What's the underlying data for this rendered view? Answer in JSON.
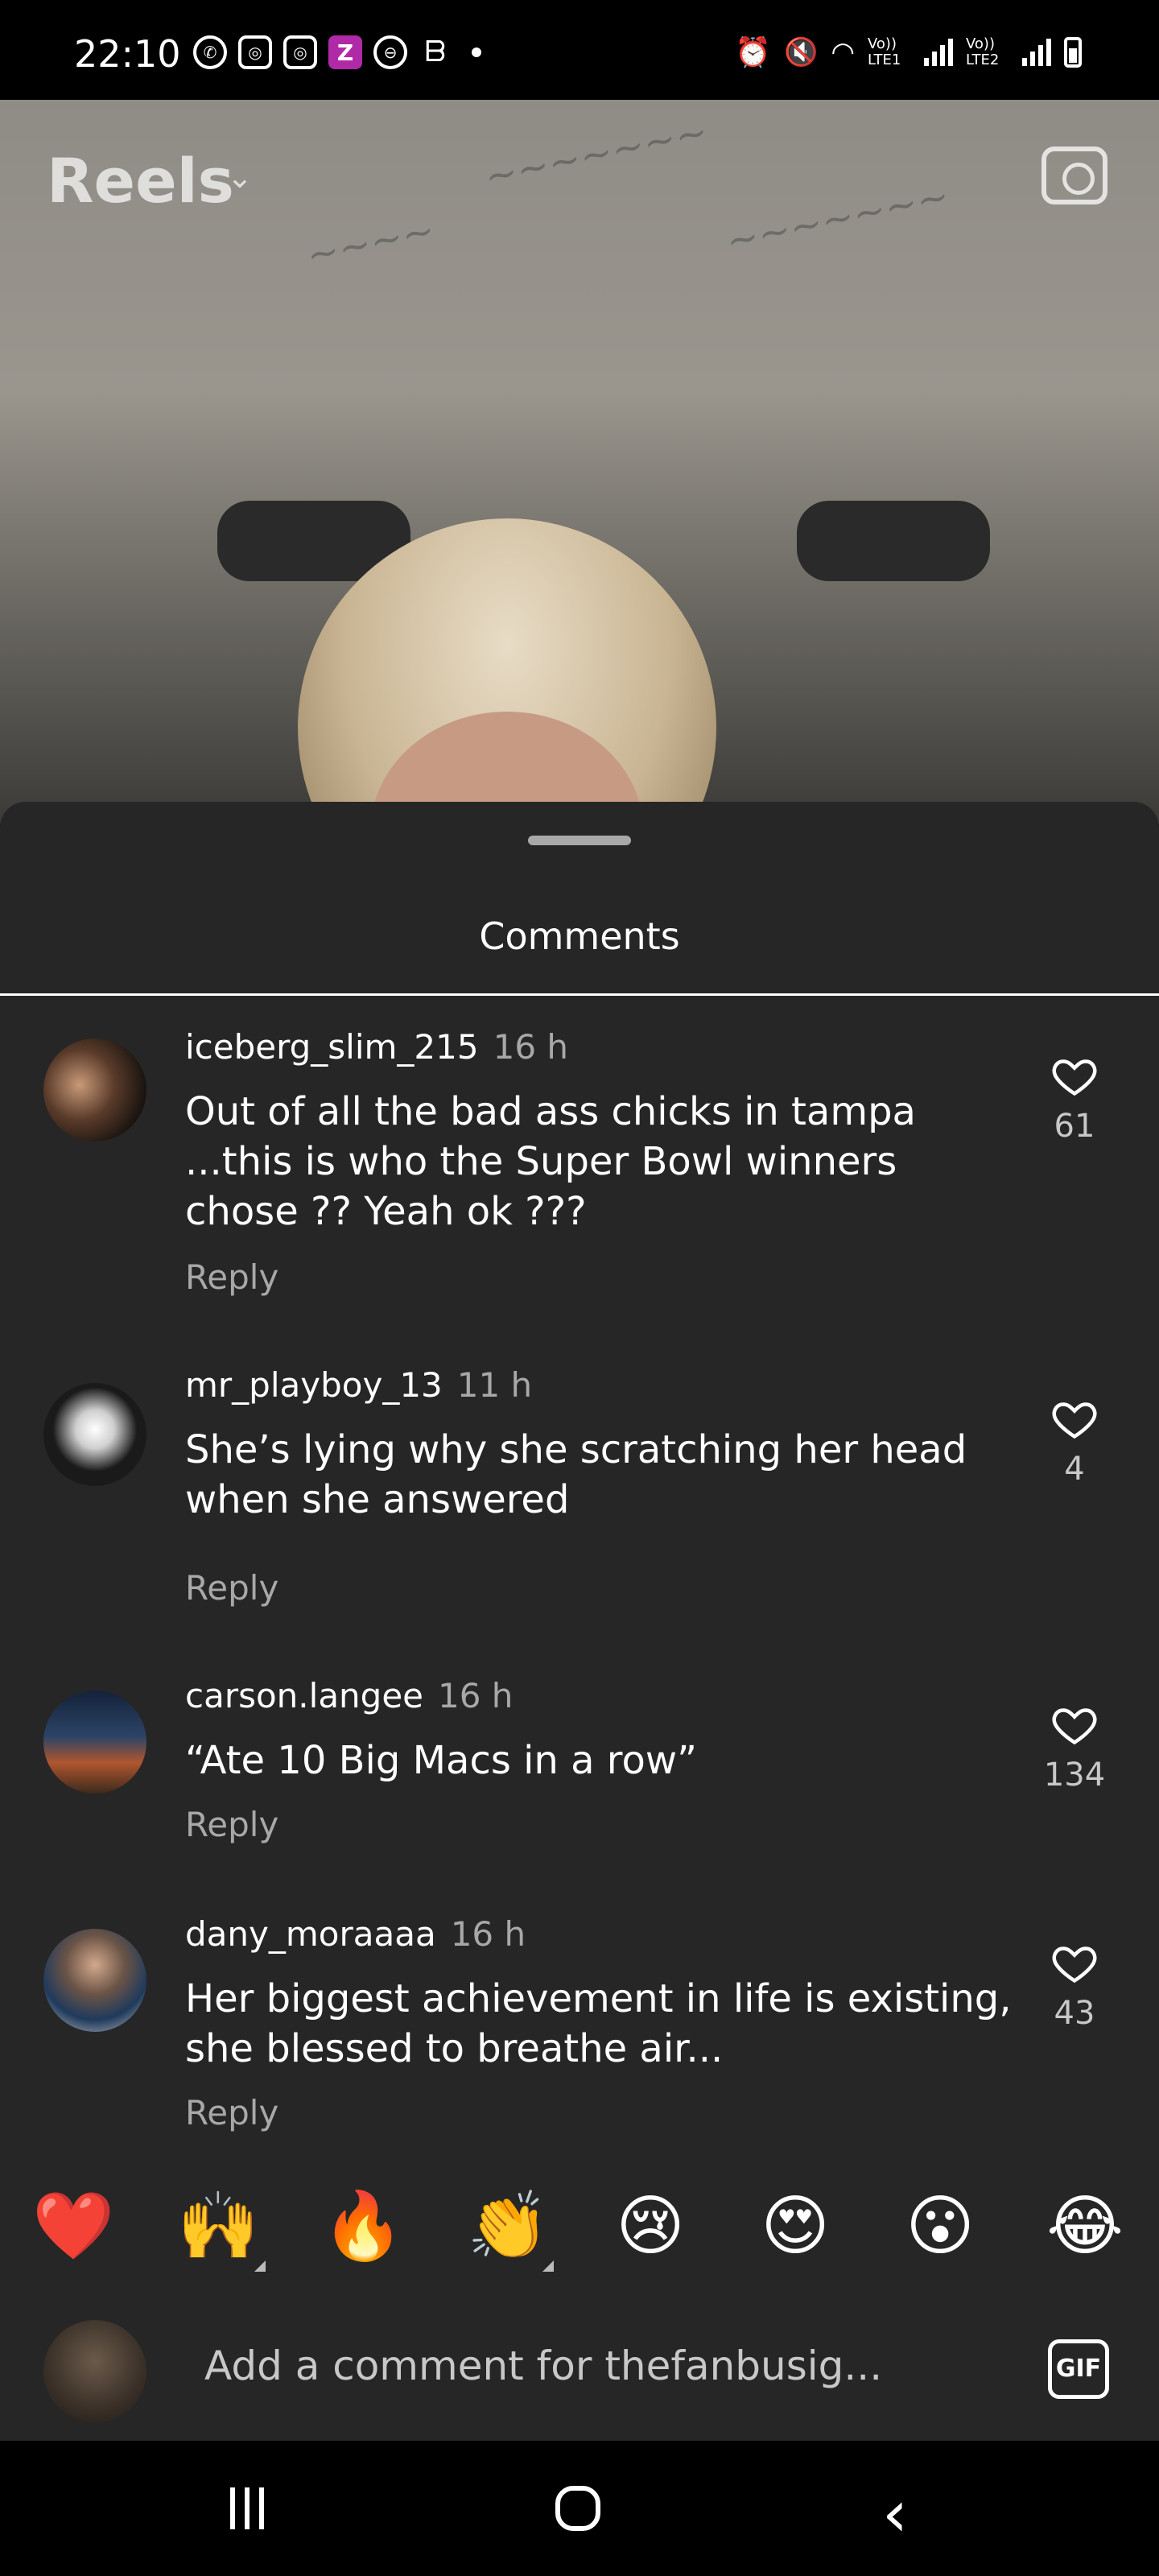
{
  "status_bar": {
    "time": "22:10",
    "network_labels": [
      "Vo)) LTE1",
      "Vo)) LTE2"
    ]
  },
  "reel": {
    "title": "Reels",
    "camera_icon": "camera-icon"
  },
  "comments_sheet": {
    "title": "Comments",
    "comments": [
      {
        "username": "iceberg_slim_215",
        "age": "16 h",
        "text": "Out of all the bad ass chicks in tampa ...this is who the Super Bowl winners chose ?? Yeah ok ???",
        "reply_label": "Reply",
        "likes": "61"
      },
      {
        "username": "mr_playboy_13",
        "age": "11 h",
        "text": "She’s lying why she scratching her head when she answered",
        "reply_label": "Reply",
        "likes": "4"
      },
      {
        "username": "carson.langee",
        "age": "16 h",
        "text": "“Ate 10 Big Macs in a row”",
        "reply_label": "Reply",
        "likes": "134"
      },
      {
        "username": "dany_moraaaa",
        "age": "16 h",
        "text": "Her biggest achievement in life is existing, she blessed to breathe air...",
        "reply_label": "Reply",
        "likes": "43"
      }
    ],
    "emoji_reactions": [
      "❤️",
      "🙌",
      "🔥",
      "👏",
      "😢",
      "😍",
      "😮",
      "😂"
    ],
    "input": {
      "placeholder": "Add a comment for thefanbusig...",
      "gif_label": "GIF"
    }
  },
  "colors": {
    "sheet_bg": "#262626",
    "secondary_text": "#a8a8a8",
    "heart_red": "#ed1c24"
  }
}
